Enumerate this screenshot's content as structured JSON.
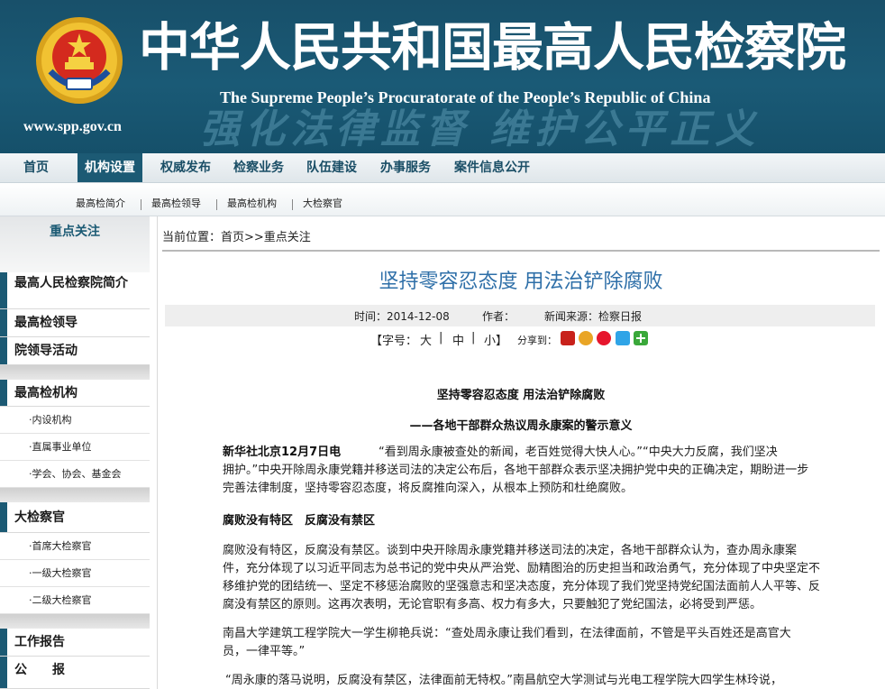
{
  "header": {
    "title_cn": "中华人民共和国最高人民检察院",
    "title_en": "The Supreme People’s Procuratorate of the People’s Republic of China",
    "url": "www.spp.gov.cn",
    "slogan": "强化法律监督 维护公平正义"
  },
  "main_nav": [
    "首页",
    "机构设置",
    "权威发布",
    "检察业务",
    "队伍建设",
    "办事服务",
    "案件信息公开"
  ],
  "main_nav_active": "机构设置",
  "sub_nav": [
    "最高检简介",
    "最高检领导",
    "最高检机构",
    "大检察官"
  ],
  "sidebar": {
    "heading": "重点关注",
    "items": [
      {
        "label": "最高人民检察院简介"
      },
      {
        "label": "最高检领导"
      },
      {
        "label": "院领导活动"
      },
      {
        "label": "最高检机构"
      },
      {
        "label": "·内设机构"
      },
      {
        "label": "·直属事业单位"
      },
      {
        "label": "·学会、协会、基金会"
      },
      {
        "label": "大检察官"
      },
      {
        "label": "·首席大检察官"
      },
      {
        "label": "·一级大检察官"
      },
      {
        "label": "·二级大检察官"
      },
      {
        "label": "工作报告"
      },
      {
        "label": "公　　报"
      }
    ]
  },
  "breadcrumb": "当前位置：首页>>重点关注",
  "article": {
    "title": "坚持零容忍态度 用法治铲除腐败",
    "time_label": "时间：2014-12-08",
    "author_label": "作者：",
    "source_label": "新闻来源：检察日报",
    "font_size": {
      "prefix": "【字号：",
      "large": "大",
      "medium": "中",
      "small": "小",
      "suffix": "】",
      "sep": "|"
    },
    "share_label": "分享到：",
    "body_title": "坚持零容忍态度 用法治铲除腐败",
    "body_subtitle": "——各地干部群众热议周永康案的警示意义",
    "dateline": "新华社北京12月7日电",
    "p1_l1": "“看到周永康被查处的新闻，老百姓觉得大快人心。”“中央大力反腐，我们坚决",
    "p1_l2": "拥护。”中央开除周永康党籍并移送司法的决定公布后，各地干部群众表示坚决拥护党中央的正确决定，期盼进一步",
    "p1_l3": "完善法律制度，坚持零容忍态度，将反腐推向深入，从根本上预防和杜绝腐败。",
    "section_heading": "腐败没有特区　反腐没有禁区",
    "p2_l1": "腐败没有特区，反腐没有禁区。谈到中央开除周永康党籍并移送司法的决定，各地干部群众认为，查办周永康案",
    "p2_l2": "件，充分体现了以习近平同志为总书记的党中央从严治党、励精图治的历史担当和政治勇气，充分体现了中央坚定不",
    "p2_l3": "移维护党的团结统一、坚定不移惩治腐败的坚强意志和坚决态度，充分体现了我们党坚持党纪国法面前人人平等、反",
    "p2_l4": "腐没有禁区的原则。这再次表明，无论官职有多高、权力有多大，只要触犯了党纪国法，必将受到严惩。",
    "p3_l1": "南昌大学建筑工程学院大一学生柳艳兵说：“查处周永康让我们看到，在法律面前，不管是平头百姓还是高官大",
    "p3_l2": "员，一律平等。”",
    "p4_l1": "“周永康的落马说明，反腐没有禁区，法律面前无特权。”南昌航空大学测试与光电工程学院大四学生林玲说，"
  },
  "colors": {
    "header_bg": "#1a5a76",
    "nav_active_bg": "#1c5a74",
    "title_blue": "#2e6fa8",
    "sidebar_bar": "#1c5a74"
  }
}
